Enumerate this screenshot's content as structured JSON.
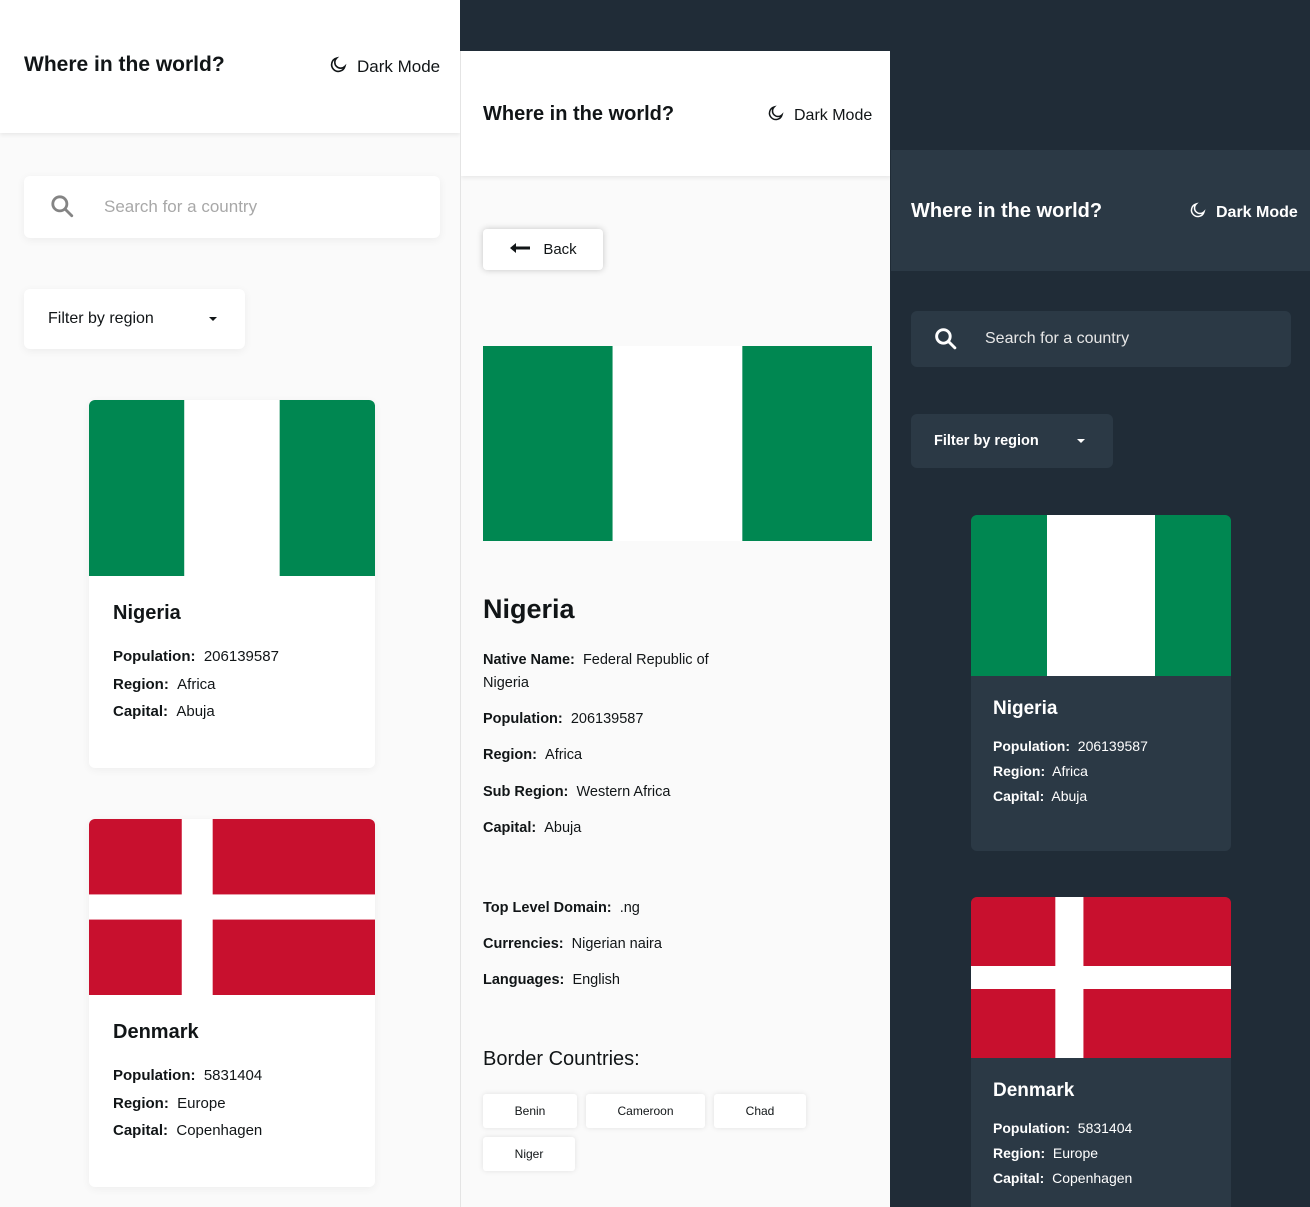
{
  "header": {
    "title": "Where in the world?",
    "dark_mode_label": "Dark Mode"
  },
  "search": {
    "placeholder": "Search for a country"
  },
  "filter": {
    "label": "Filter by region"
  },
  "labels": {
    "population": "Population:",
    "region": "Region:",
    "capital": "Capital:",
    "native_name": "Native Name:",
    "sub_region": "Sub Region:",
    "top_level_domain": "Top Level Domain:",
    "currencies": "Currencies:",
    "languages": "Languages:",
    "border_countries": "Border Countries:"
  },
  "countries": [
    {
      "name": "Nigeria",
      "population": "206139587",
      "region": "Africa",
      "capital": "Abuja"
    },
    {
      "name": "Denmark",
      "population": "5831404",
      "region": "Europe",
      "capital": "Copenhagen"
    }
  ],
  "detail": {
    "back_label": "Back",
    "name": "Nigeria",
    "native_name": "Federal Republic of Nigeria",
    "population": "206139587",
    "region": "Africa",
    "sub_region": "Western Africa",
    "capital": "Abuja",
    "top_level_domain": ".ng",
    "currencies": "Nigerian naira",
    "languages": "English",
    "border_countries": [
      "Benin",
      "Cameroon",
      "Chad",
      "Niger"
    ]
  },
  "colors": {
    "nigeria_green": "#008751",
    "denmark_red": "#c8102e",
    "dark_bg": "#202c37",
    "dark_element": "#2b3945",
    "light_bg": "#fafafa"
  },
  "icons": [
    "moon-icon",
    "search-icon",
    "chevron-down-icon",
    "arrow-left-icon"
  ]
}
